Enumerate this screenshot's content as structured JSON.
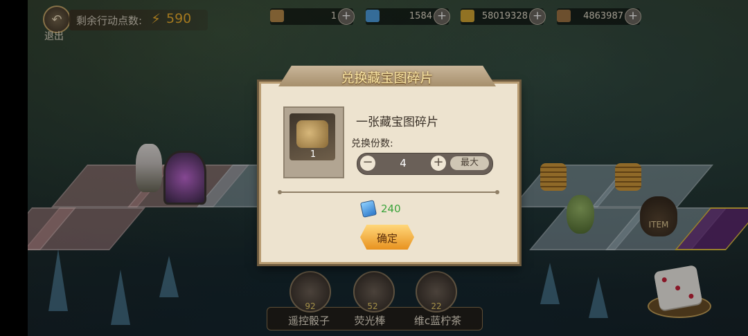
{
  "topbar": {
    "exit_icon": "back-arrow-icon",
    "exit_label": "退出",
    "action_points_label": "剩余行动点数:",
    "action_points_icon": "lightning-icon",
    "action_points_value": "590",
    "resources": [
      {
        "icon": "treasure-chest-icon",
        "value": "1"
      },
      {
        "icon": "blue-crystal-icon",
        "value": "1584"
      },
      {
        "icon": "gold-hexagon-icon",
        "value": "58019328"
      },
      {
        "icon": "bronze-shield-icon",
        "value": "4863987"
      }
    ],
    "add_label": "+"
  },
  "dialog": {
    "title": "兑换藏宝图碎片",
    "item_name": "一张藏宝图碎片",
    "item_icon": "treasure-map-fragment-icon",
    "item_count": "1",
    "quantity_label": "兑换份数:",
    "minus_label": "−",
    "quantity_value": "4",
    "plus_label": "+",
    "max_label": "最大",
    "cost_icon": "blue-crystal-icon",
    "cost_value": "240",
    "confirm_label": "确定"
  },
  "board": {
    "item_bag_label": "ITEM",
    "dice_icon": "dice-icon"
  },
  "tools": [
    {
      "icon": "remote-dice-icon",
      "count": "92",
      "name": "遥控骰子"
    },
    {
      "icon": "glow-stick-icon",
      "count": "52",
      "name": "荧光棒"
    },
    {
      "icon": "lemon-tea-icon",
      "count": "22",
      "name": "维c蓝柠茶"
    }
  ],
  "colors": {
    "accent_gold": "#f0b12e",
    "cost_green": "#3aa33a",
    "dialog_bg": "#ede3cf",
    "confirm_orange": "#e8921f"
  }
}
